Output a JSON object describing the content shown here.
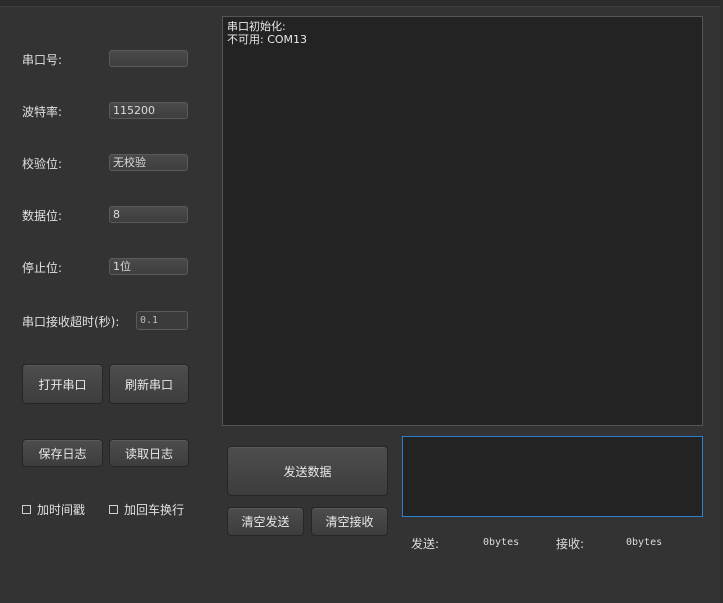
{
  "settings": {
    "port_label": "串口号:",
    "port_value": "",
    "baud_label": "波特率:",
    "baud_value": "115200",
    "parity_label": "校验位:",
    "parity_value": "无校验",
    "databits_label": "数据位:",
    "databits_value": "8",
    "stopbits_label": "停止位:",
    "stopbits_value": "1位",
    "timeout_label": "串口接收超时(秒):",
    "timeout_value": "0.1"
  },
  "buttons": {
    "open_port": "打开串口",
    "refresh_port": "刷新串口",
    "save_log": "保存日志",
    "read_log": "读取日志",
    "send_data": "发送数据",
    "clear_send": "清空发送",
    "clear_recv": "清空接收"
  },
  "checkboxes": {
    "timestamp": "加时间戳",
    "newline": "加回车换行"
  },
  "receive": {
    "lines": [
      "串口初始化:",
      "不可用: COM13"
    ]
  },
  "send_box": {
    "value": ""
  },
  "status": {
    "sent_label": "发送:",
    "sent_value": "0bytes",
    "recv_label": "接收:",
    "recv_value": "0bytes"
  }
}
